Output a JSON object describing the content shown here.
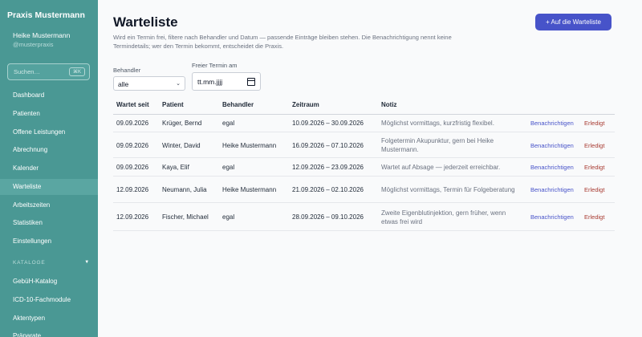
{
  "sidebar": {
    "brand": "Praxis Mustermann",
    "user_name": "Heike Mustermann",
    "user_handle": "@musterpraxis",
    "search_placeholder": "Suchen…",
    "search_shortcut": "⌘K",
    "items": [
      {
        "label": "Dashboard",
        "active": false
      },
      {
        "label": "Patienten",
        "active": false
      },
      {
        "label": "Offene Leistungen",
        "active": false
      },
      {
        "label": "Abrechnung",
        "active": false
      },
      {
        "label": "Kalender",
        "active": false
      },
      {
        "label": "Warteliste",
        "active": true
      },
      {
        "label": "Arbeitszeiten",
        "active": false
      },
      {
        "label": "Statistiken",
        "active": false
      },
      {
        "label": "Einstellungen",
        "active": false
      }
    ],
    "section_label": "KATALOGE",
    "section_items": [
      {
        "label": "GebüH-Katalog"
      },
      {
        "label": "ICD-10-Fachmodule"
      },
      {
        "label": "Aktentypen"
      },
      {
        "label": "Präparate"
      }
    ]
  },
  "main": {
    "title": "Warteliste",
    "description": "Wird ein Termin frei, filtere nach Behandler und Datum — passende Einträge bleiben stehen. Die Benachrichtigung nennt keine Termindetails; wer den Termin bekommt, entscheidet die Praxis.",
    "add_button": "+ Auf die Warteliste",
    "filters": {
      "behandler_label": "Behandler",
      "behandler_value": "alle",
      "termin_label": "Freier Termin am",
      "termin_value": "tt.mm.jjjj"
    },
    "table": {
      "columns": [
        "Wartet seit",
        "Patient",
        "Behandler",
        "Zeitraum",
        "Notiz"
      ],
      "action_notify": "Benachrichtigen",
      "action_done": "Erledigt",
      "rows": [
        {
          "since": "09.09.2026",
          "patient": "Krüger, Bernd",
          "behandler": "egal",
          "zeitraum": "10.09.2026 – 30.09.2026",
          "notiz": "Möglichst vormittags, kurzfristig flexibel."
        },
        {
          "since": "09.09.2026",
          "patient": "Winter, David",
          "behandler": "Heike Mustermann",
          "zeitraum": "16.09.2026 – 07.10.2026",
          "notiz": "Folgetermin Akupunktur, gern bei Heike Mustermann."
        },
        {
          "since": "09.09.2026",
          "patient": "Kaya, Elif",
          "behandler": "egal",
          "zeitraum": "12.09.2026 – 23.09.2026",
          "notiz": "Wartet auf Absage — jederzeit erreichbar."
        },
        {
          "since": "12.09.2026",
          "patient": "Neumann, Julia",
          "behandler": "Heike Mustermann",
          "zeitraum": "21.09.2026 – 02.10.2026",
          "notiz": "Möglichst vormittags, Termin für Folgeberatung"
        },
        {
          "since": "12.09.2026",
          "patient": "Fischer, Michael",
          "behandler": "egal",
          "zeitraum": "28.09.2026 – 09.10.2026",
          "notiz": "Zweite Eigenblutinjektion, gern früher, wenn etwas frei wird"
        }
      ]
    }
  },
  "colors": {
    "sidebar": "#4a9894",
    "accent": "#4753c9",
    "danger": "#a83b32"
  }
}
